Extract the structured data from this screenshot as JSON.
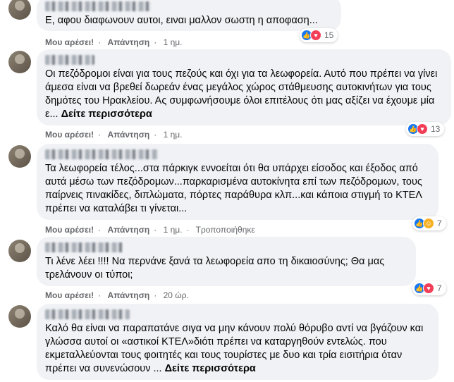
{
  "actions": {
    "like": "Μου αρέσει!",
    "reply": "Απάντηση",
    "edited": "Τροποποιήθηκε"
  },
  "comments": [
    {
      "text": "Ε, αφου διαφωνουν αυτοι, ειναι μαλλον σωστη η αποφαση...",
      "time": "1 ημ.",
      "reactions": {
        "icons": [
          "like-icon",
          "love-icon"
        ],
        "count": "15"
      }
    },
    {
      "text": "Οι πεζόδρομοι είναι για τους πεζούς και όχι για τα λεωφορεία. Αυτό που πρέπει να γίνει άμεσα είναι να βρεθεί δωρεάν ένας μεγάλος χώρος στάθμευσης αυτοκινήτων για τους δημότες του Ηρακλείου. Ας συμφωνήσουμε όλοι επιτέλους ότι μας αξίζει να έχουμε μία ε...",
      "see_more": "Δείτε περισσότερα",
      "time": "1 ημ.",
      "reactions": {
        "icons": [
          "like-icon",
          "love-icon"
        ],
        "count": "13"
      }
    },
    {
      "text": "Τα λεωφορεία τέλος...στα πάρκιγκ εννοείται ότι θα υπάρχει είσοδος και έξοδος από αυτά μέσω των πεζόδρομων...παρκαρισμένα αυτοκίνητα επί των πεζόδρομων, τους παίρνεις πινακίδες, διπλώματα, πόρτες παράθυρα κλπ...και κάποια στιγμή το ΚΤΕΛ πρέπει να καταλάβει τι γίνεται...",
      "time": "1 ημ.",
      "reactions": {
        "icons": [
          "like-icon",
          "haha-icon"
        ],
        "count": "7"
      }
    },
    {
      "text": "Τι λένε λέει !!!! Να περνάνε ξανά τα λεωφορεία απο τη δικαιοσύνης; Θα μας τρελάνουν οι τύποι;",
      "time": "20 ώρ.",
      "reactions": {
        "icons": [
          "like-icon",
          "love-icon"
        ],
        "count": "7"
      }
    },
    {
      "text": "Καλό θα είναι να παραπατάνε σιγα να μην κάνουν πολύ θόρυβο αντί να βγάζουν και γλώσσα αυτοί οι «αστικοί ΚΤΕΛ»διότι πρέπει να καταργηθούν εντελώς. που εκμεταλλεύονται τους φοιτητές και τους τουρίστες με δυο και τρία εισιτήρια όταν πρέπει να συνενώσουν ...",
      "see_more": "Δείτε περισσότερα"
    }
  ]
}
